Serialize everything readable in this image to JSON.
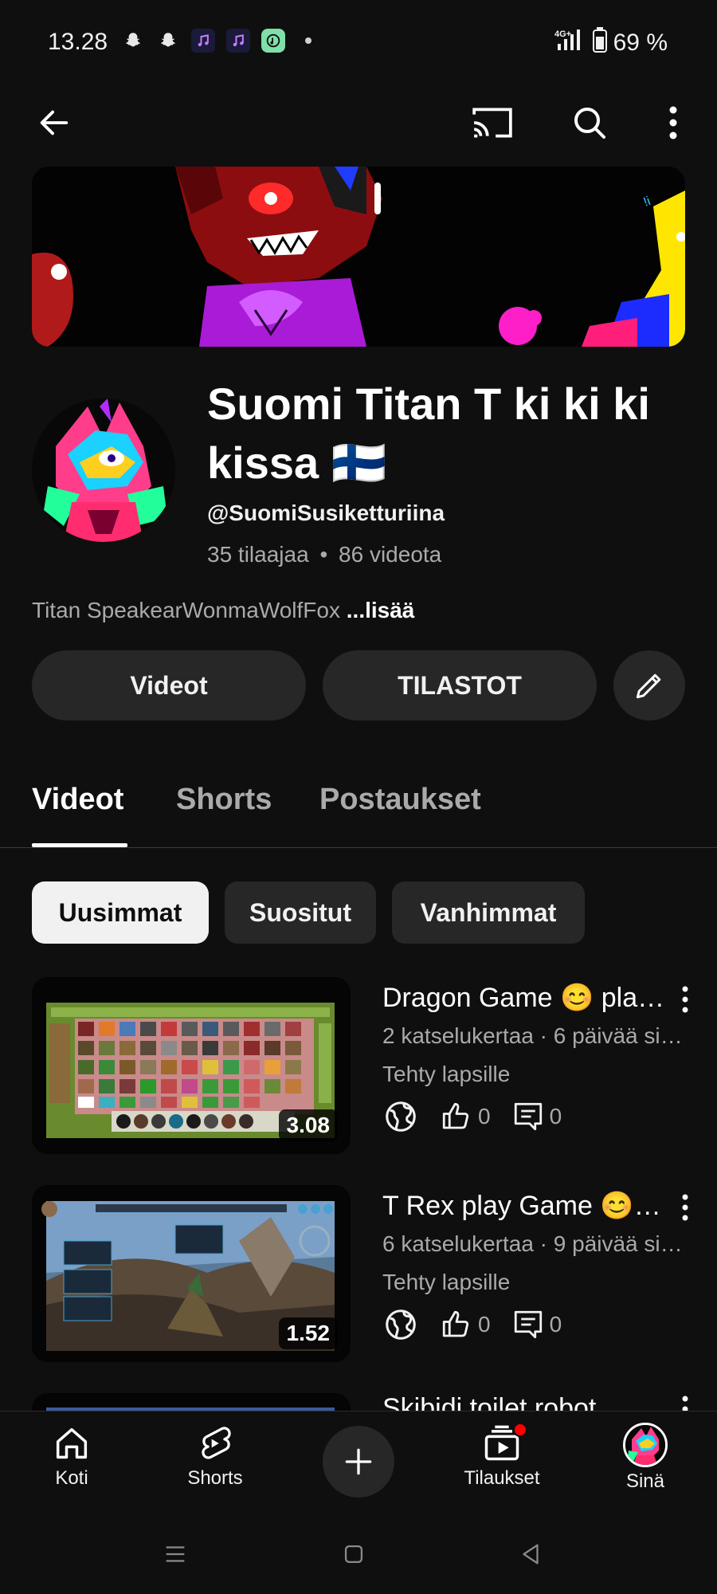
{
  "status_bar": {
    "time": "13.28",
    "network": "4G+",
    "battery": "69 %"
  },
  "channel": {
    "name": "Suomi Titan T ki ki ki kissa 🇫🇮",
    "handle": "@SuomiSusiketturiina",
    "subscribers": "35 tilaajaa",
    "video_count": "86 videota",
    "stats_separator": "•",
    "description": "Titan SpeakearWonmaWolfFox",
    "more_label": "...lisää"
  },
  "actions": {
    "videos_button": "Videot",
    "stats_button": "TILASTOT"
  },
  "tabs": [
    "Videot",
    "Shorts",
    "Postaukset"
  ],
  "active_tab": "Videot",
  "chips": [
    "Uusimmat",
    "Suositut",
    "Vanhimmat"
  ],
  "active_chip": "Uusimmat",
  "videos": [
    {
      "title": "Dragon Game 😊 pla…",
      "meta": "2 katselukertaa · 6 päivää si…",
      "made_for_kids": "Tehty lapsille",
      "likes": "0",
      "comments": "0",
      "duration": "3.08"
    },
    {
      "title": "T Rex play Game 😊…",
      "meta": "6 katselukertaa · 9 päivää si…",
      "made_for_kids": "Tehty lapsille",
      "likes": "0",
      "comments": "0",
      "duration": "1.52"
    },
    {
      "title": "Skibidi toilet robot"
    }
  ],
  "bottom_nav": {
    "home": "Koti",
    "shorts": "Shorts",
    "subscriptions": "Tilaukset",
    "you": "Sinä"
  },
  "colors": {
    "background": "#0f0f0f",
    "surface": "#272727",
    "text_primary": "#f1f1f1",
    "text_secondary": "#aaaaaa",
    "notification": "#ff0000"
  }
}
